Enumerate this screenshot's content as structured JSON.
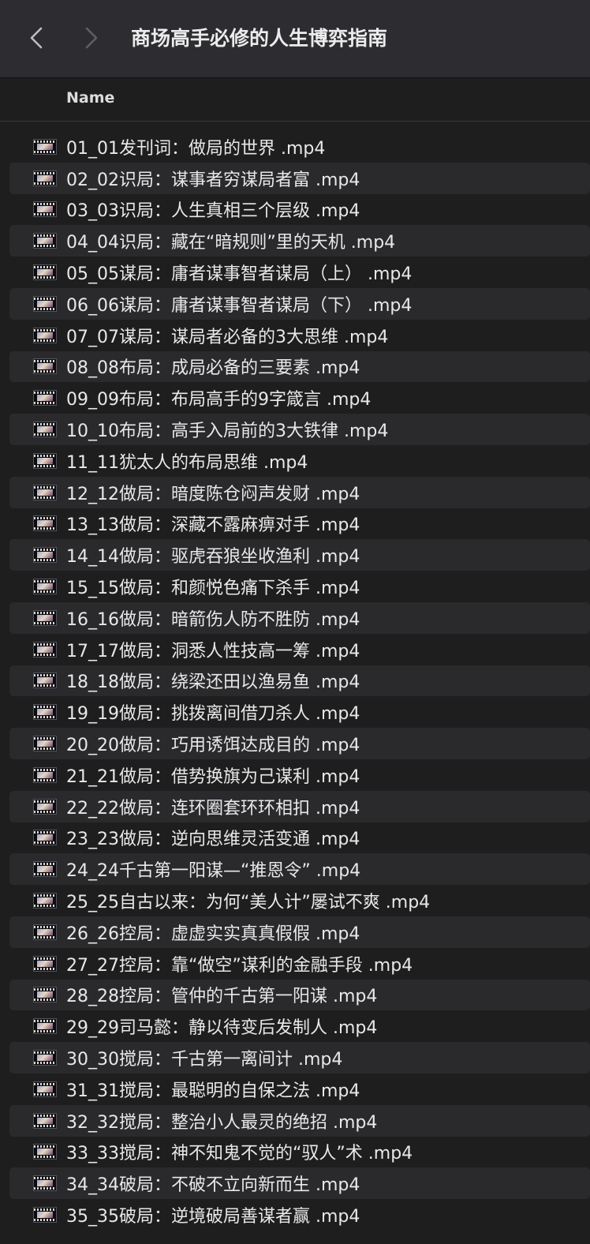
{
  "window": {
    "title": "商场高手必修的人生博弈指南",
    "back_icon": "chevron-left-icon",
    "forward_icon": "chevron-right-icon"
  },
  "header": {
    "column_name": "Name"
  },
  "files": [
    "01_01发刊词：做局的世界 .mp4",
    "02_02识局：谋事者穷谋局者富 .mp4",
    "03_03识局：人生真相三个层级 .mp4",
    "04_04识局：藏在“暗规则”里的天机 .mp4",
    "05_05谋局：庸者谋事智者谋局（上） .mp4",
    "06_06谋局：庸者谋事智者谋局（下） .mp4",
    "07_07谋局：谋局者必备的3大思维 .mp4",
    "08_08布局：成局必备的三要素 .mp4",
    "09_09布局：布局高手的9字箴言 .mp4",
    "10_10布局：高手入局前的3大铁律 .mp4",
    "11_11犹太人的布局思维 .mp4",
    "12_12做局：暗度陈仓闷声发财 .mp4",
    "13_13做局：深藏不露麻痹对手 .mp4",
    "14_14做局：驱虎吞狼坐收渔利 .mp4",
    "15_15做局：和颜悦色痛下杀手 .mp4",
    "16_16做局：暗箭伤人防不胜防 .mp4",
    "17_17做局：洞悉人性技高一筹 .mp4",
    "18_18做局：绕梁还田以渔易鱼 .mp4",
    "19_19做局：挑拨离间借刀杀人 .mp4",
    "20_20做局：巧用诱饵达成目的 .mp4",
    "21_21做局：借势换旗为己谋利 .mp4",
    "22_22做局：连环圈套环环相扣 .mp4",
    "23_23做局：逆向思维灵活变通 .mp4",
    "24_24千古第一阳谋—“推恩令” .mp4",
    "25_25自古以来：为何“美人计”屡试不爽 .mp4",
    "26_26控局：虚虚实实真真假假 .mp4",
    "27_27控局：靠“做空”谋利的金融手段 .mp4",
    "28_28控局：管仲的千古第一阳谋 .mp4",
    "29_29司马懿：静以待变后发制人 .mp4",
    "30_30搅局：千古第一离间计 .mp4",
    "31_31搅局：最聪明的自保之法 .mp4",
    "32_32搅局：整治小人最灵的绝招 .mp4",
    "33_33搅局：神不知鬼不觉的“驭人”术 .mp4",
    "34_34破局：不破不立向新而生 .mp4",
    "35_35破局：逆境破局善谋者赢 .mp4"
  ],
  "file_icon": "video-file-icon",
  "colors": {
    "titlebar": "#2d2c31",
    "background": "#1e1e1e",
    "alt_row": "#2a2a2d",
    "text": "#e8e8e8"
  }
}
